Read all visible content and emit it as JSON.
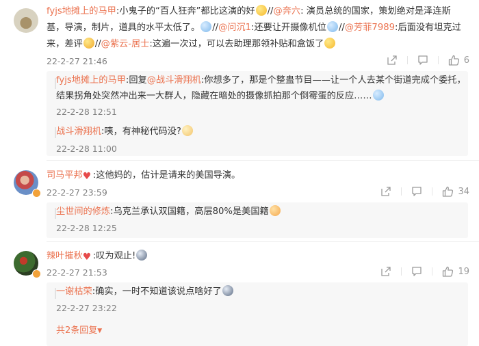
{
  "comments": [
    {
      "user": "fyjs地摊上的马甲",
      "line1_a": ":小鬼子的“百人狂奔”都比这演的好",
      "line1_b": "//",
      "line1_mention1": "@奔六",
      "line1_c": ": 演员总统的国家，策划绝对是泽连斯",
      "line2_a": "基，导演，制片，道具的水平太低了。",
      "line2_b": "//",
      "line2_mention2": "@问沉1",
      "line2_c": ":还要让开摄像机位",
      "line2_d": "//",
      "line2_mention3": "@芳菲7989",
      "line2_e": ":后面没有坦克过",
      "line3_a": "来，差评",
      "line3_b": "//",
      "line3_mention4": "@紫云-居士",
      "line3_c": ":这遍一次过，可以去助理那领补贴和盒饭了",
      "time": "22-2-27 21:46",
      "likes": "6",
      "replies": [
        {
          "user": "fyjs地摊上的马甲",
          "text_a": ":回复",
          "mention": "@战斗滑翔机",
          "text_b": ":你想多了，那是个整蛊节目——让一个人去某个街道完成个委托，",
          "text_c": "结果拐角处突然冲出来一大群人，隐藏在暗处的摄像抓拍那个倒霉蛋的反应……",
          "time": "22-2-28 12:51"
        },
        {
          "user": "战斗滑翔机",
          "text": ":咦，有神秘代码没?",
          "time": "22-2-28 11:00"
        }
      ]
    },
    {
      "user": "司马平邦",
      "text": ":这他妈的，估计是请来的美国导演。",
      "time": "22-2-27 23:59",
      "likes": "34",
      "replies": [
        {
          "user": "尘世间的修炼",
          "text": ":乌克兰承认双国籍，高层80%是美国籍",
          "time": "22-2-28 12:25"
        }
      ]
    },
    {
      "user": "辣叶摧秋",
      "text": ":叹为观止!",
      "time": "22-2-27 21:53",
      "likes": "19",
      "replies": [
        {
          "user": "一谢枯荣",
          "text": ":确实，一时不知道该说点啥好了",
          "time": "22-2-27 23:22"
        }
      ],
      "more_replies": "共2条回复"
    }
  ],
  "colors": {
    "username": "#eb7350",
    "time": "#808080",
    "icon": "#999999"
  },
  "icons": [
    "share-icon",
    "reply-icon",
    "like-icon",
    "heart-emoji-icon"
  ]
}
